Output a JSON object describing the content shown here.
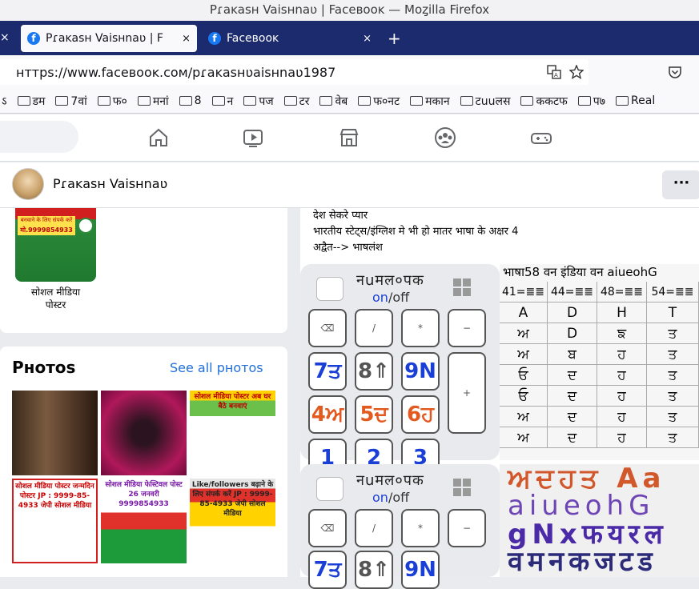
{
  "window": {
    "title": "Pɾaĸaѕн Vaiѕнnaʋ | Faϲeвooĸ — Moȥilla Firefox"
  },
  "tabs": [
    {
      "label": "Pɾaĸaѕн Vaiѕнnaʋ | F",
      "close": "×"
    },
    {
      "label": "Faϲeвooĸ",
      "close": "×"
    }
  ],
  "tab_leftover_close": "×",
  "new_tab": "+",
  "url": "нттpѕ://www.faϲeвooĸ.ϲoм/pɾaĸaѕнʋaiѕнnaʋ1987",
  "bookmarks": [
    "डम",
    "7वां",
    "फ०",
    "मनां",
    "8",
    "न",
    "पज",
    "टर",
    "वेब",
    "फ०नट",
    "मकान",
    "टuuलस",
    "ककटफ",
    "प७",
    "Real"
  ],
  "bookmark_first": "ऽ",
  "profile": {
    "name": "Pɾaĸaѕн Vaiѕнnaʋ",
    "more": "···"
  },
  "featured": {
    "label_line1": "सोशल मीडिया",
    "label_line2": "पोस्टर",
    "thumb_top": "बनवाने के लिए संपर्क करें",
    "thumb_title": "का पोस्टर",
    "thumb_phone": "मो.9999854933"
  },
  "photos": {
    "title": "Pнoтoѕ",
    "see_all": "See all pнoтoѕ",
    "tiles": [
      {
        "text": ""
      },
      {
        "text": ""
      },
      {
        "text": "सोशल मीडिया पोस्टर अब घर बैठे बनवाएं"
      },
      {
        "text": "सोशल मीडिया पोस्टर जन्मदिन पोस्टर JP : 9999-85-4933 जेपी सोशल मीडिया"
      },
      {
        "text": "सोशल मीडिया फेस्टिवल पोस्ट 26 जनवरी 9999854933"
      },
      {
        "text": "Like/followers बढ़ाने के लिए संपर्क करें JP : 9999-85-4933 जेपी सोशल मीडिया"
      }
    ]
  },
  "post": {
    "line1": "देश सेकरे प्यार",
    "line2": "भारतीय स्टेट्स/इंग्लिश मे भी हो मातर भाषा के अक्षर 4",
    "line3": "अद्वैत--> भाषलंश"
  },
  "keyboard": {
    "title": "नuमल०पक",
    "on": "on",
    "slash": "/",
    "off": "off",
    "keys_row1": [
      "⌫",
      "/",
      "*",
      "−"
    ],
    "keys_row2": [
      "7ਤ",
      "8⇑",
      "9N",
      "+"
    ],
    "keys_row3": [
      "4ਅ",
      "5ਦ",
      "6ਹ"
    ],
    "keys_row4": [
      "1",
      "2",
      "3"
    ]
  },
  "table": {
    "header": "भाषा58 वन इंडिया वन aiueohG",
    "rows": [
      [
        "41=≣≣",
        "44=≣≣",
        "48=≣≣",
        "54=≣≣"
      ],
      [
        "A",
        "D",
        "H",
        "T"
      ],
      [
        "ਅ",
        "D",
        "ਙ",
        "ਤ"
      ],
      [
        "ਅ",
        "ਬ",
        "ਹ",
        "ਤ"
      ],
      [
        "ਓ",
        "ਦ",
        "ਹ",
        "ਤ"
      ],
      [
        "ਓ",
        "ਦ",
        "ਹ",
        "ਤ"
      ],
      [
        "ਅ",
        "ਦ",
        "ਹ",
        "ਤ"
      ],
      [
        "ਅ",
        "ਦ",
        "ਹ",
        "ਤ"
      ]
    ]
  },
  "big_letters": {
    "line1": "ਅਦਹਤ Aa",
    "line2": "aiueohG",
    "line3": "gNxफयरल",
    "line4": "वमनकजटड"
  }
}
